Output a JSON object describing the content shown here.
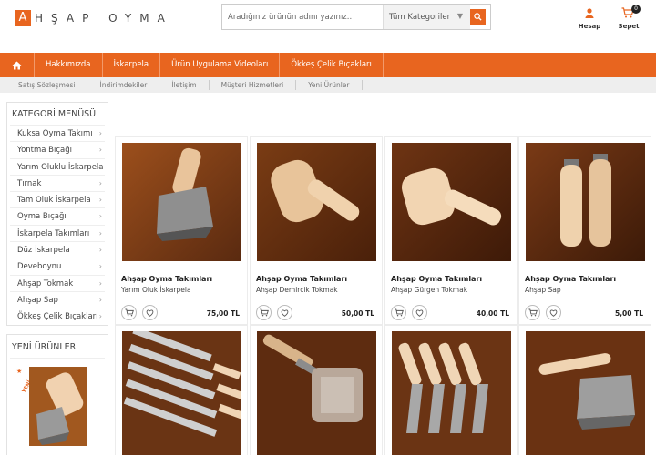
{
  "brand": {
    "logo_letter": "A",
    "logo_text": "HŞAP OYMA"
  },
  "search": {
    "placeholder": "Aradığınız ürünün adını yazınız..",
    "category": "Tüm Kategoriler"
  },
  "header": {
    "account_label": "Hesap",
    "cart_label": "Sepet",
    "cart_count": "0"
  },
  "main_nav": [
    "Hakkımızda",
    "İskarpela",
    "Ürün Uygulama Videoları",
    "Ökkeş Çelik Bıçakları"
  ],
  "sub_nav": [
    "Satış Sözleşmesi",
    "İndirimdekiler",
    "İletişim",
    "Müşteri Hizmetleri",
    "Yeni Ürünler"
  ],
  "sidebar": {
    "category_title": "KATEGORİ MENÜSÜ",
    "categories": [
      "Kuksa Oyma Takımı",
      "Yontma Bıçağı",
      "Yarım Oluklu İskarpela",
      "Tırnak",
      "Tam Oluk İskarpela",
      "Oyma Bıçağı",
      "İskarpela Takımları",
      "Düz İskarpela",
      "Deveboynu",
      "Ahşap Tokmak",
      "Ahşap Sap",
      "Ökkeş Çelik Bıçakları"
    ],
    "new_title": "YENİ ÜRÜNLER",
    "new_badge": "YENİ"
  },
  "products": [
    {
      "title": "Ahşap Oyma Takımları",
      "subtitle": "Yarım Oluk İskarpela",
      "price": "75,00 TL"
    },
    {
      "title": "Ahşap Oyma Takımları",
      "subtitle": "Ahşap Demircik Tokmak",
      "price": "50,00 TL"
    },
    {
      "title": "Ahşap Oyma Takımları",
      "subtitle": "Ahşap Gürgen Tokmak",
      "price": "40,00 TL"
    },
    {
      "title": "Ahşap Oyma Takımları",
      "subtitle": "Ahşap Sap",
      "price": "5,00 TL"
    }
  ],
  "colors": {
    "accent": "#e8651f",
    "wood_bg": "#6b3a1a"
  }
}
